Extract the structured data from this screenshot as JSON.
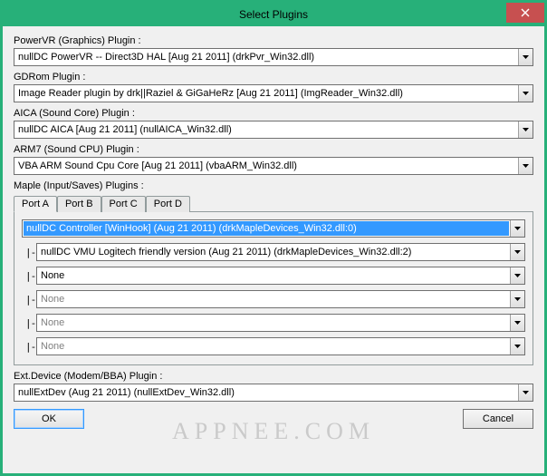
{
  "window": {
    "title": "Select Plugins"
  },
  "labels": {
    "powervr": "PowerVR (Graphics) Plugin :",
    "gdrom": "GDRom Plugin :",
    "aica": "AICA (Sound Core) Plugin :",
    "arm7": "ARM7 (Sound CPU) Plugin :",
    "maple": "Maple (Input/Saves) Plugins :",
    "extdev": "Ext.Device (Modem/BBA) Plugin :"
  },
  "values": {
    "powervr": "nullDC PowerVR -- Direct3D HAL [Aug 21 2011] (drkPvr_Win32.dll)",
    "gdrom": "Image Reader plugin by drk||Raziel & GiGaHeRz [Aug 21 2011] (ImgReader_Win32.dll)",
    "aica": "nullDC AICA [Aug 21 2011] (nullAICA_Win32.dll)",
    "arm7": "VBA ARM Sound Cpu Core [Aug 21 2011] (vbaARM_Win32.dll)",
    "extdev": "nullExtDev (Aug 21 2011) (nullExtDev_Win32.dll)"
  },
  "tabs": [
    "Port A",
    "Port B",
    "Port C",
    "Port D"
  ],
  "maple": {
    "main": "nullDC Controller [WinHook] (Aug 21 2011) (drkMapleDevices_Win32.dll:0)",
    "sub1": "nullDC VMU Logitech friendly version (Aug 21 2011) (drkMapleDevices_Win32.dll:2)",
    "sub2": "None",
    "sub3": "None",
    "sub4": "None",
    "sub5": "None"
  },
  "buttons": {
    "ok": "OK",
    "cancel": "Cancel"
  },
  "watermark": "APPNEE.COM"
}
